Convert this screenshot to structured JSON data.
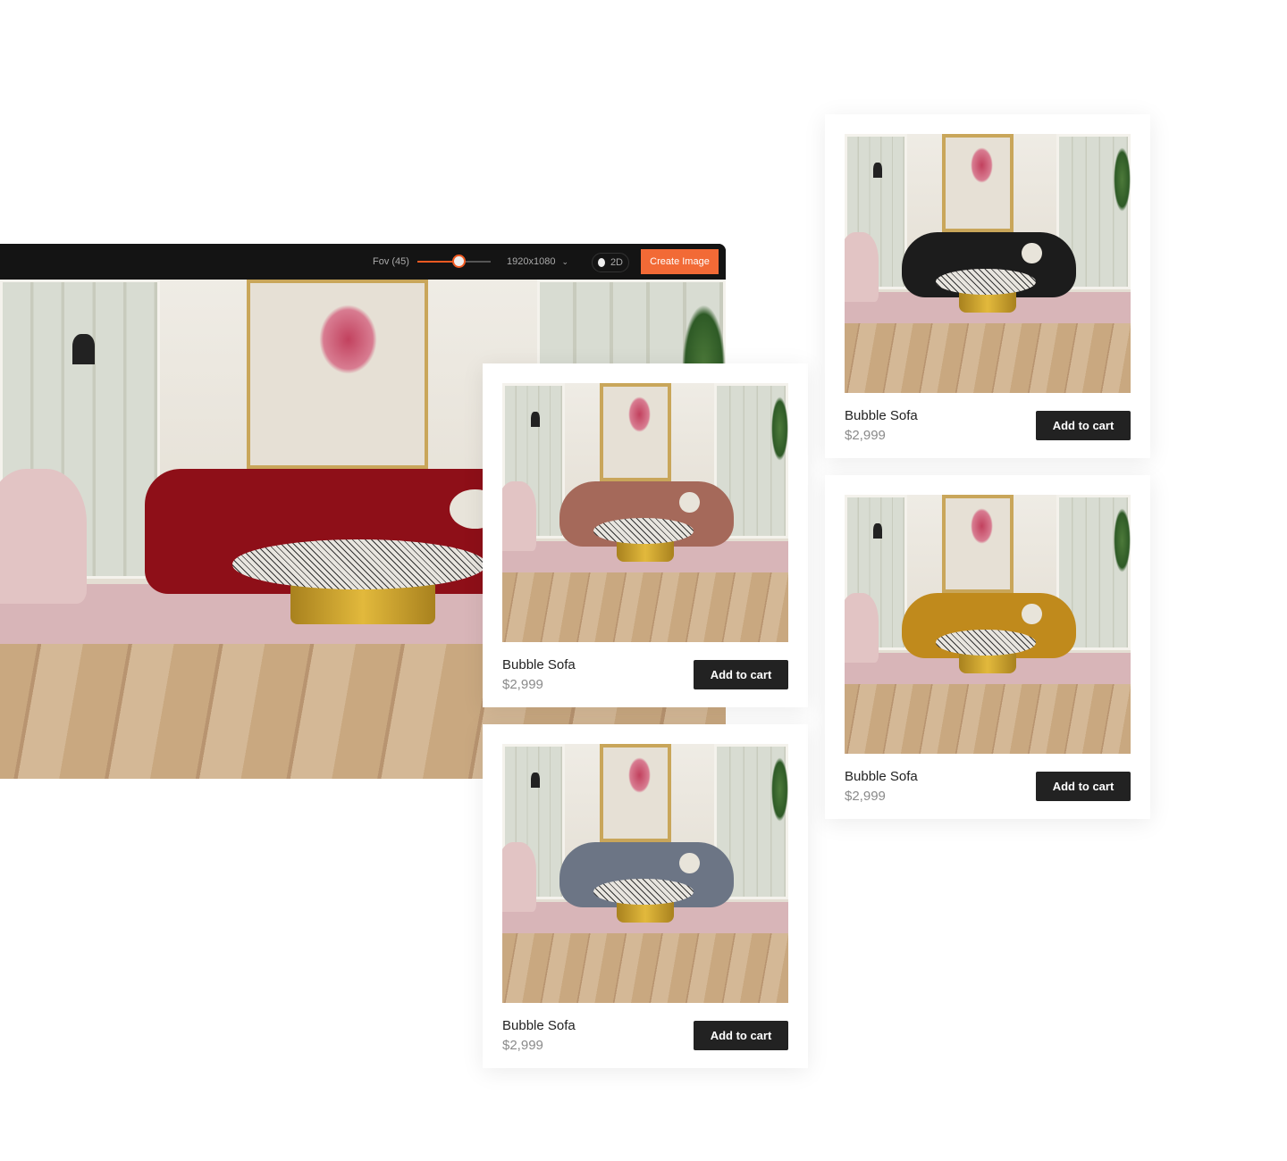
{
  "toolbar": {
    "fov_label": "Fov (45)",
    "fov_slider_fraction": 0.56,
    "resolution": "1920x1080",
    "mode_toggle_label": "2D",
    "create_button": "Create Image",
    "accent_color": "#f26a36"
  },
  "main_scene": {
    "sofa_color": "#8e0f18"
  },
  "products": [
    {
      "title": "Bubble Sofa",
      "price": "$2,999",
      "button": "Add to cart",
      "sofa_color": "#a5695a"
    },
    {
      "title": "Bubble Sofa",
      "price": "$2,999",
      "button": "Add to cart",
      "sofa_color": "#6c7585"
    },
    {
      "title": "Bubble Sofa",
      "price": "$2,999",
      "button": "Add to cart",
      "sofa_color": "#1c1c1c"
    },
    {
      "title": "Bubble Sofa",
      "price": "$2,999",
      "button": "Add to cart",
      "sofa_color": "#c08a1c"
    }
  ]
}
